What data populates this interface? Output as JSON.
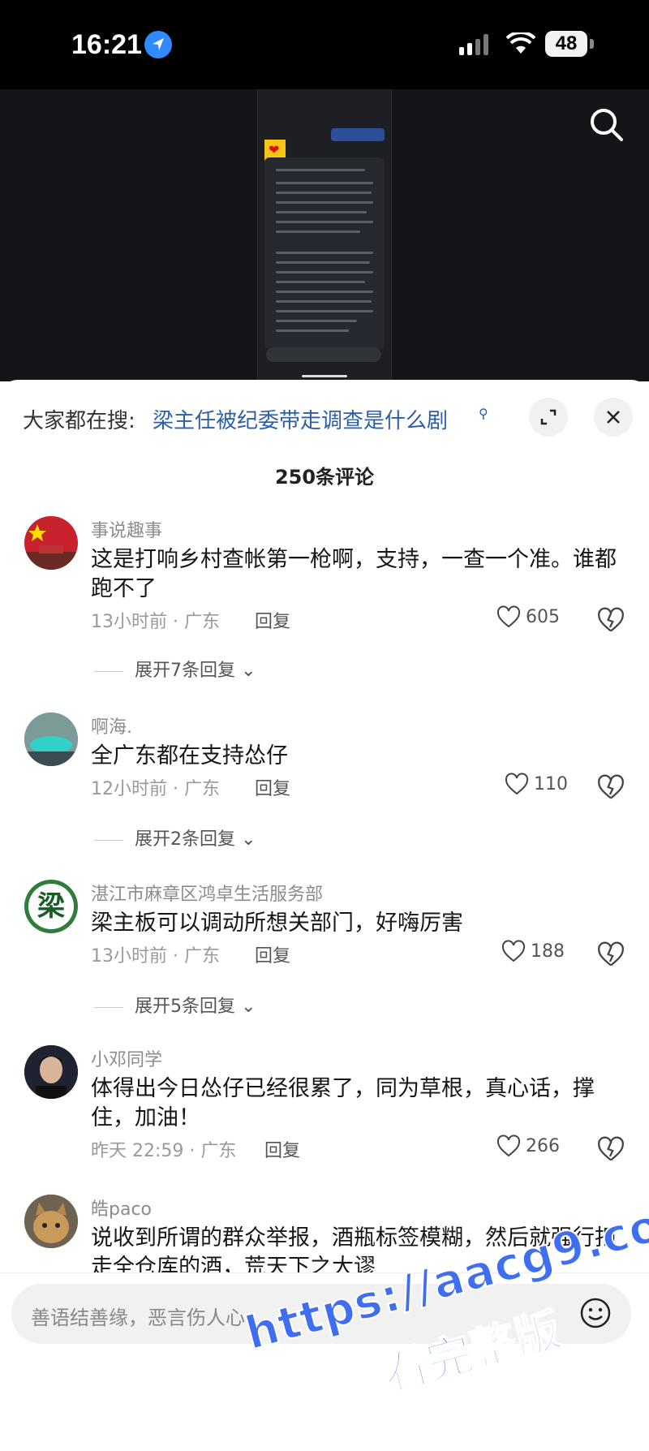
{
  "status": {
    "time": "16:21",
    "battery": "48"
  },
  "sheet": {
    "search_prefix": "大家都在搜:",
    "search_query": "梁主任被纪委带走调查是什么剧",
    "comment_count": "250条评论"
  },
  "comments": [
    {
      "user": "事说趣事",
      "text": "这是打响乡村查帐第一枪啊，支持，一查一个准。谁都跑不了",
      "time_loc": "13小时前 · 广东",
      "reply": "回复",
      "likes": "605",
      "expand": "展开7条回复"
    },
    {
      "user": "啊海.",
      "text": "全广东都在支持怂仔",
      "time_loc": "12小时前 · 广东",
      "reply": "回复",
      "likes": "110",
      "expand": "展开2条回复"
    },
    {
      "user": "湛江市麻章区鸿卓生活服务部",
      "text": "梁主板可以调动所想关部门，好嗨厉害",
      "time_loc": "13小时前 · 广东",
      "reply": "回复",
      "likes": "188",
      "expand": "展开5条回复",
      "avatar_char": "梁"
    },
    {
      "user": "小邓同学",
      "text": "体得出今日怂仔已经很累了，同为草根，真心话，撑住，加油！",
      "time_loc": "昨天 22:59 · 广东",
      "reply": "回复",
      "likes": "266"
    },
    {
      "user": "皓paco",
      "text": "说收到所谓的群众举报，酒瓶标签模糊，然后就强行扣走全仓库的酒，荒天下之大谬"
    }
  ],
  "input": {
    "placeholder": "善语结善缘，恶言伤人心"
  },
  "watermark": {
    "line1": "https://aacg9.com",
    "line2": "看完整版"
  },
  "colors": {
    "link": "#2c5fa8",
    "watermark": "#3f6ff0"
  }
}
